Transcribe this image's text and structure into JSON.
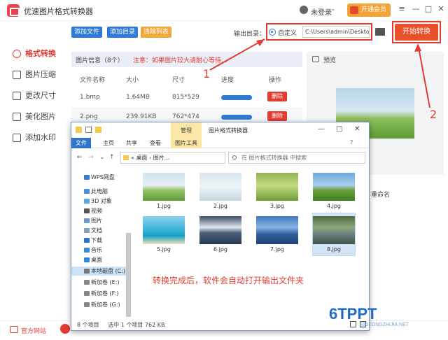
{
  "app": {
    "title": "优速图片格式转换器",
    "user_status": "未登录",
    "vip_label": "开通会员",
    "window_controls": [
      "≡",
      "—",
      "□",
      "✕"
    ]
  },
  "nav": {
    "items": [
      {
        "label": "格式转换",
        "active": true
      },
      {
        "label": "图片压缩"
      },
      {
        "label": "更改尺寸"
      },
      {
        "label": "美化图片"
      },
      {
        "label": "添加水印"
      }
    ]
  },
  "toolbar": {
    "add_file": "添加文件",
    "add_folder": "添加目录",
    "clear_list": "清除列表",
    "output_label": "输出目录：",
    "custom_label": "自定义",
    "output_path": "C:\\Users\\admin\\Deskto",
    "start_label": "开始转换",
    "colors": {
      "add_file": "#2f7ad6",
      "add_folder": "#2f7ad6",
      "clear_list": "#f0a83a"
    }
  },
  "file_info": {
    "title": "图片信息（8个）",
    "warning": "注意：如果图片较大请耐心等待...",
    "columns": [
      "文件名称",
      "大小",
      "尺寸",
      "进度",
      "操作"
    ],
    "rows": [
      {
        "name": "1.bmp",
        "size": "1.64MB",
        "dims": "815*529",
        "progress": 1.0,
        "action": "删除"
      },
      {
        "name": "2.png",
        "size": "239.91KB",
        "dims": "762*474",
        "progress": 1.0,
        "action": "删除"
      }
    ]
  },
  "preview": {
    "title": "预览",
    "rename_label": "重命名"
  },
  "annotations": {
    "one": "1",
    "two": "2"
  },
  "bottom": {
    "site_label": "官方网站"
  },
  "explorer": {
    "manage_tab": "管理",
    "title": "图片格式转换器",
    "ribbon_tabs": [
      "文件",
      "主页",
      "共享",
      "查看",
      "图片工具"
    ],
    "address": "« 桌面 › 图片...",
    "search_placeholder": "在 图片格式转换器 中搜索",
    "tree": [
      "WPS网盘",
      "此电脑",
      "3D 对象",
      "视频",
      "图片",
      "文档",
      "下载",
      "音乐",
      "桌面",
      "本地磁盘 (C:)",
      "新加卷 (E:)",
      "新加卷 (F:)",
      "新加卷 (G:)"
    ],
    "files": [
      "1.jpg",
      "2.jpg",
      "3.jpg",
      "4.jpg",
      "5.jpg",
      "6.jpg",
      "7.jpg",
      "8.jpg"
    ],
    "selected_file": "8.jpg",
    "note": "转换完成后，软件会自动打开输出文件夹",
    "status_count": "8 个项目",
    "status_selected": "选中 1 个项目  762 KB"
  },
  "watermark": {
    "logo": "6TPPT",
    "sub": "XITONGZHIJIA.NET"
  }
}
